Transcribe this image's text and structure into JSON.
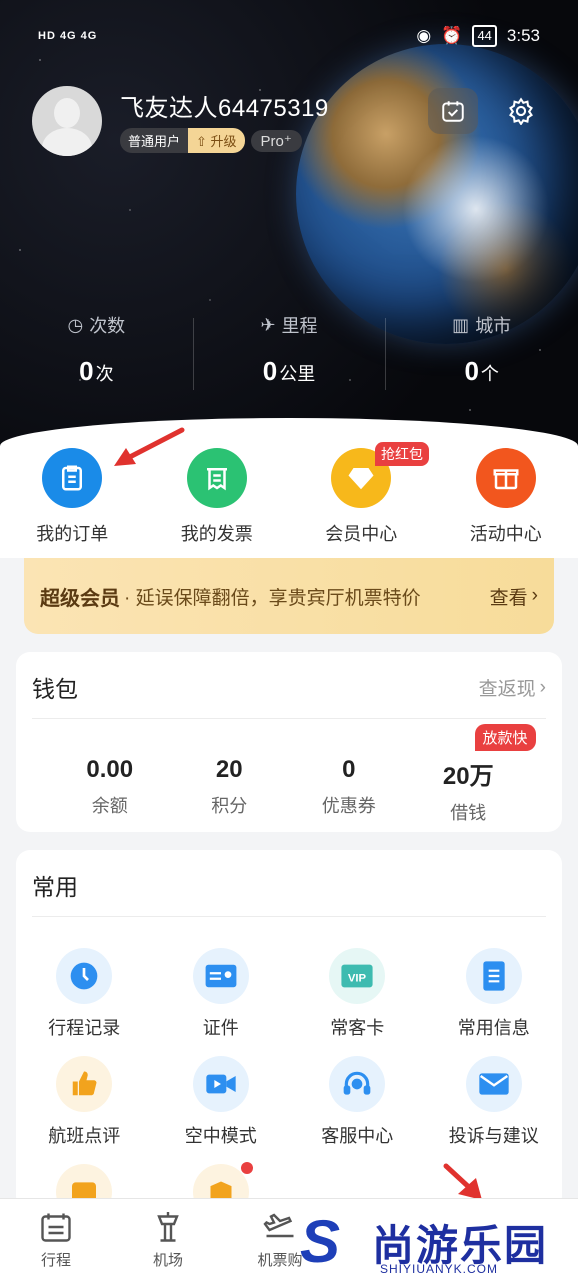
{
  "status_bar": {
    "left_text": "HD 4G 4G",
    "battery": "44",
    "time": "3:53"
  },
  "profile": {
    "name": "飞友达人64475319",
    "badge_user": "普通用户",
    "badge_upgrade": "升级",
    "badge_pro": "Pro⁺"
  },
  "stats": [
    {
      "label": "次数",
      "value": "0",
      "unit": "次"
    },
    {
      "label": "里程",
      "value": "0",
      "unit": "公里"
    },
    {
      "label": "城市",
      "value": "0",
      "unit": "个"
    }
  ],
  "quick": [
    {
      "label": "我的订单",
      "color": "#1a8be8"
    },
    {
      "label": "我的发票",
      "color": "#2bc273"
    },
    {
      "label": "会员中心",
      "color": "#f7b81b",
      "tag": "抢红包"
    },
    {
      "label": "活动中心",
      "color": "#f2561e"
    }
  ],
  "vip": {
    "title": "超级会员",
    "desc": "· 延误保障翻倍，享贵宾厅机票特价",
    "action": "查看"
  },
  "wallet": {
    "title": "钱包",
    "link": "查返现",
    "items": [
      {
        "value": "0.00",
        "label": "余额"
      },
      {
        "value": "20",
        "label": "积分"
      },
      {
        "value": "0",
        "label": "优惠券"
      },
      {
        "value": "20万",
        "label": "借钱",
        "tag": "放款快"
      }
    ]
  },
  "common": {
    "title": "常用",
    "items": [
      {
        "label": "行程记录",
        "icon": "clock-icon"
      },
      {
        "label": "证件",
        "icon": "id-card-icon"
      },
      {
        "label": "常客卡",
        "icon": "vip-card-icon"
      },
      {
        "label": "常用信息",
        "icon": "document-icon"
      },
      {
        "label": "航班点评",
        "icon": "thumbs-up-icon"
      },
      {
        "label": "空中模式",
        "icon": "video-icon"
      },
      {
        "label": "客服中心",
        "icon": "headset-icon"
      },
      {
        "label": "投诉与建议",
        "icon": "mail-icon"
      }
    ]
  },
  "tabbar": [
    {
      "label": "行程"
    },
    {
      "label": "机场"
    },
    {
      "label": "机票购"
    }
  ],
  "watermark": {
    "cn": "尚游乐园",
    "en": "SHIYIUANYK.COM"
  }
}
